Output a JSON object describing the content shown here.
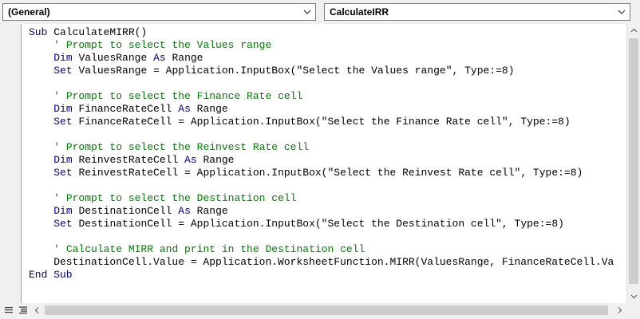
{
  "toolbar": {
    "object_combo": "(General)",
    "procedure_combo": "CalculateIRR"
  },
  "code_lines": [
    [
      {
        "t": "kw",
        "v": "Sub "
      },
      {
        "t": "tx",
        "v": "CalculateMIRR()"
      }
    ],
    [
      {
        "t": "tx",
        "v": "    "
      },
      {
        "t": "cm",
        "v": "' Prompt to select the Values range"
      }
    ],
    [
      {
        "t": "tx",
        "v": "    "
      },
      {
        "t": "kw",
        "v": "Dim "
      },
      {
        "t": "tx",
        "v": "ValuesRange "
      },
      {
        "t": "kw",
        "v": "As "
      },
      {
        "t": "tx",
        "v": "Range"
      }
    ],
    [
      {
        "t": "tx",
        "v": "    "
      },
      {
        "t": "kw",
        "v": "Set "
      },
      {
        "t": "tx",
        "v": "ValuesRange = Application.InputBox(\"Select the Values range\", Type:=8)"
      }
    ],
    [
      {
        "t": "tx",
        "v": ""
      }
    ],
    [
      {
        "t": "tx",
        "v": "    "
      },
      {
        "t": "cm",
        "v": "' Prompt to select the Finance Rate cell"
      }
    ],
    [
      {
        "t": "tx",
        "v": "    "
      },
      {
        "t": "kw",
        "v": "Dim "
      },
      {
        "t": "tx",
        "v": "FinanceRateCell "
      },
      {
        "t": "kw",
        "v": "As "
      },
      {
        "t": "tx",
        "v": "Range"
      }
    ],
    [
      {
        "t": "tx",
        "v": "    "
      },
      {
        "t": "kw",
        "v": "Set "
      },
      {
        "t": "tx",
        "v": "FinanceRateCell = Application.InputBox(\"Select the Finance Rate cell\", Type:=8)"
      }
    ],
    [
      {
        "t": "tx",
        "v": ""
      }
    ],
    [
      {
        "t": "tx",
        "v": "    "
      },
      {
        "t": "cm",
        "v": "' Prompt to select the Reinvest Rate cell"
      }
    ],
    [
      {
        "t": "tx",
        "v": "    "
      },
      {
        "t": "kw",
        "v": "Dim "
      },
      {
        "t": "tx",
        "v": "ReinvestRateCell "
      },
      {
        "t": "kw",
        "v": "As "
      },
      {
        "t": "tx",
        "v": "Range"
      }
    ],
    [
      {
        "t": "tx",
        "v": "    "
      },
      {
        "t": "kw",
        "v": "Set "
      },
      {
        "t": "tx",
        "v": "ReinvestRateCell = Application.InputBox(\"Select the Reinvest Rate cell\", Type:=8)"
      }
    ],
    [
      {
        "t": "tx",
        "v": ""
      }
    ],
    [
      {
        "t": "tx",
        "v": "    "
      },
      {
        "t": "cm",
        "v": "' Prompt to select the Destination cell"
      }
    ],
    [
      {
        "t": "tx",
        "v": "    "
      },
      {
        "t": "kw",
        "v": "Dim "
      },
      {
        "t": "tx",
        "v": "DestinationCell "
      },
      {
        "t": "kw",
        "v": "As "
      },
      {
        "t": "tx",
        "v": "Range"
      }
    ],
    [
      {
        "t": "tx",
        "v": "    "
      },
      {
        "t": "kw",
        "v": "Set "
      },
      {
        "t": "tx",
        "v": "DestinationCell = Application.InputBox(\"Select the Destination cell\", Type:=8)"
      }
    ],
    [
      {
        "t": "tx",
        "v": ""
      }
    ],
    [
      {
        "t": "tx",
        "v": "    "
      },
      {
        "t": "cm",
        "v": "' Calculate MIRR and print in the Destination cell"
      }
    ],
    [
      {
        "t": "tx",
        "v": "    DestinationCell.Value = Application.WorksheetFunction.MIRR(ValuesRange, FinanceRateCell.Va"
      }
    ],
    [
      {
        "t": "kw",
        "v": "End Sub"
      }
    ]
  ],
  "colors": {
    "keyword": "#00008b",
    "comment": "#008000",
    "text": "#000000"
  },
  "icons": {
    "dropdown": "chevron-down-icon",
    "procedure_view": "procedure-view-icon",
    "full_module_view": "full-module-view-icon",
    "scroll_up": "arrow-up-icon",
    "scroll_down": "arrow-down-icon",
    "scroll_left": "arrow-left-icon",
    "scroll_right": "arrow-right-icon"
  }
}
